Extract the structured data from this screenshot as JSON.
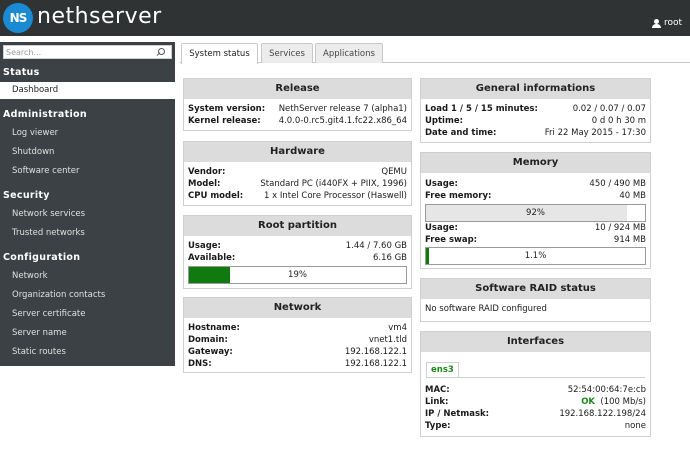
{
  "app": {
    "logo_text": "NS",
    "brand": "nethserver",
    "user": "root"
  },
  "search": {
    "placeholder": "Search..."
  },
  "sidebar": {
    "sections": [
      {
        "title": "Status",
        "items": [
          "Dashboard"
        ]
      },
      {
        "title": "Administration",
        "items": [
          "Log viewer",
          "Shutdown",
          "Software center"
        ]
      },
      {
        "title": "Security",
        "items": [
          "Network services",
          "Trusted networks"
        ]
      },
      {
        "title": "Configuration",
        "items": [
          "Network",
          "Organization contacts",
          "Server certificate",
          "Server name",
          "Static routes"
        ]
      }
    ]
  },
  "tabs": [
    "System status",
    "Services",
    "Applications"
  ],
  "release": {
    "title": "Release",
    "rows": [
      {
        "k": "System version:",
        "v": "NethServer release 7 (alpha1)"
      },
      {
        "k": "Kernel release:",
        "v": "4.0.0-0.rc5.git4.1.fc22.x86_64"
      }
    ]
  },
  "hardware": {
    "title": "Hardware",
    "rows": [
      {
        "k": "Vendor:",
        "v": "QEMU"
      },
      {
        "k": "Model:",
        "v": "Standard PC (i440FX + PIIX, 1996)"
      },
      {
        "k": "CPU model:",
        "v": "1 x Intel Core Processor (Haswell)"
      }
    ]
  },
  "root_partition": {
    "title": "Root partition",
    "rows": [
      {
        "k": "Usage:",
        "v": "1.44 / 7.60 GB"
      },
      {
        "k": "Available:",
        "v": "6.16 GB"
      }
    ],
    "bar": {
      "label": "19%",
      "percent": 19,
      "color": "#0f7a0f"
    }
  },
  "network": {
    "title": "Network",
    "rows": [
      {
        "k": "Hostname:",
        "v": "vm4"
      },
      {
        "k": "Domain:",
        "v": "vnet1.tld"
      },
      {
        "k": "Gateway:",
        "v": "192.168.122.1"
      },
      {
        "k": "DNS:",
        "v": "192.168.122.1"
      }
    ]
  },
  "general": {
    "title": "General informations",
    "rows": [
      {
        "k": "Load 1 / 5 / 15 minutes:",
        "v": "0.02 / 0.07 / 0.07"
      },
      {
        "k": "Uptime:",
        "v": "0 d 0 h 30 m"
      },
      {
        "k": "Date and time:",
        "v": "Fri 22 May 2015 - 17:30"
      }
    ]
  },
  "memory": {
    "title": "Memory",
    "rows": [
      {
        "k": "Usage:",
        "v": "450 / 490 MB"
      },
      {
        "k": "Free memory:",
        "v": "40 MB"
      }
    ],
    "bar1": {
      "label": "92%",
      "percent": 92,
      "color": "#e6e6e6"
    },
    "rows2": [
      {
        "k": "Usage:",
        "v": "10 / 924 MB"
      },
      {
        "k": "Free swap:",
        "v": "914 MB"
      }
    ],
    "bar2": {
      "label": "1.1%",
      "percent": 1.1,
      "color": "#0f7a0f"
    }
  },
  "raid": {
    "title": "Software RAID status",
    "text": "No software RAID configured"
  },
  "interfaces": {
    "title": "Interfaces",
    "tab": "ens3",
    "rows": [
      {
        "k": "MAC:",
        "v": "52:54:00:64:7e:cb"
      },
      {
        "k": "Link:",
        "v_ok": "OK",
        "v": "(100 Mb/s)"
      },
      {
        "k": "IP / Netmask:",
        "v": "192.168.122.198/24"
      },
      {
        "k": "Type:",
        "v": "none"
      }
    ]
  }
}
